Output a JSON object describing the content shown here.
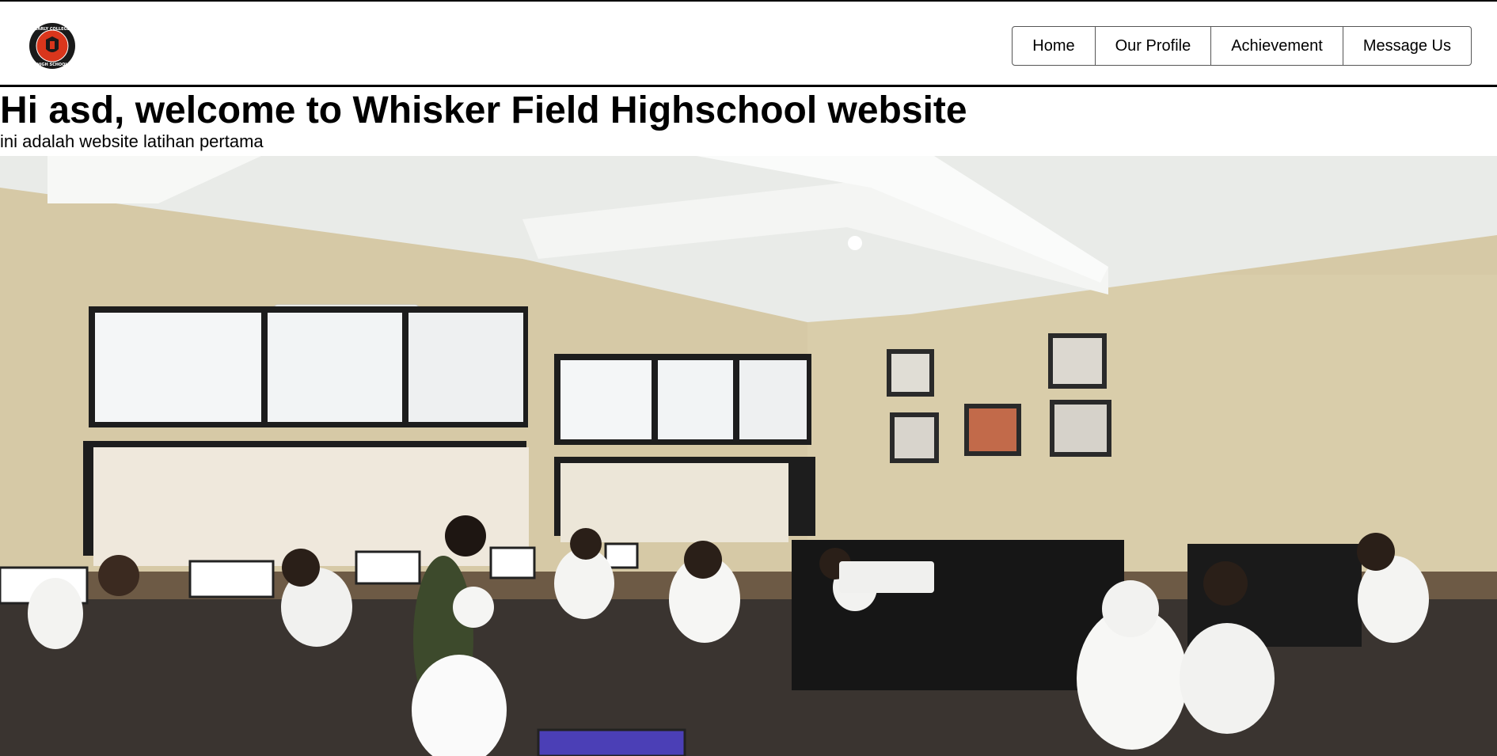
{
  "header": {
    "logo_alt": "EARLY COLLEGE HIGH SCHOOL",
    "logo_text_top": "EARLY COLLEGE",
    "logo_text_bottom": "HIGH SCHOOL",
    "nav": [
      {
        "label": "Home"
      },
      {
        "label": "Our Profile"
      },
      {
        "label": "Achievement"
      },
      {
        "label": "Message Us"
      }
    ]
  },
  "main": {
    "welcome": "Hi asd, welcome to Whisker Field Highschool website",
    "subtitle": "ini adalah website latihan pertama"
  },
  "hero": {
    "image_alt": "Students in a computer lab classroom"
  },
  "colors": {
    "logo_red": "#d9361c",
    "logo_dark": "#1a1a1a",
    "wall": "#d8ccab",
    "ceiling": "#eef0ee"
  }
}
